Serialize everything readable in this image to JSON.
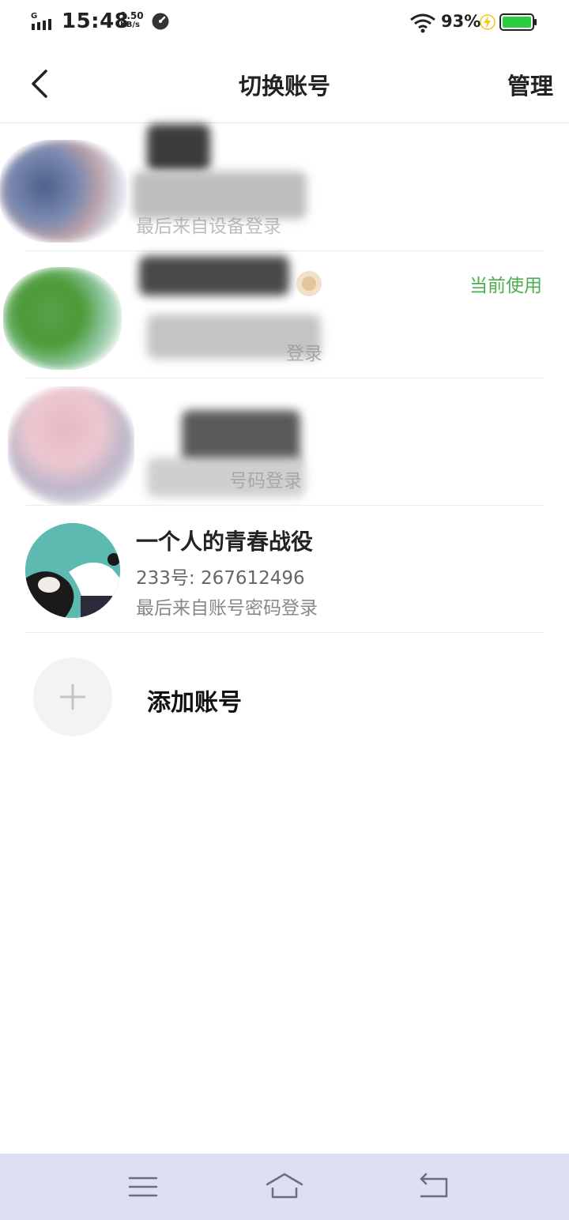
{
  "status_bar": {
    "network_type": "G",
    "time": "15:48",
    "speed_value": "1.50",
    "speed_unit": "KB/s",
    "battery_percent": "93%",
    "battery_color": "#2ecc40"
  },
  "header": {
    "title": "切换账号",
    "manage_label": "管理"
  },
  "accounts": [
    {
      "name": "",
      "id_text": "",
      "login_text": "最后来自设备登录",
      "current": ""
    },
    {
      "name": "",
      "id_text": "",
      "login_text": "登录",
      "current": "当前使用"
    },
    {
      "name": "",
      "id_text": "",
      "login_text": "号码登录",
      "current": ""
    },
    {
      "name": "一个人的青春战役",
      "id_text": "233号: 267612496",
      "login_text": "最后来自账号密码登录",
      "current": ""
    }
  ],
  "add_account": {
    "label": "添加账号"
  },
  "colors": {
    "accent_current": "#4caf50",
    "nav_bar_bg": "#dde0f5",
    "divider": "#ececec"
  },
  "icons": {
    "back": "chevron-left-icon",
    "add": "plus-icon",
    "menu": "menu-icon",
    "home": "home-icon",
    "return": "return-icon"
  }
}
